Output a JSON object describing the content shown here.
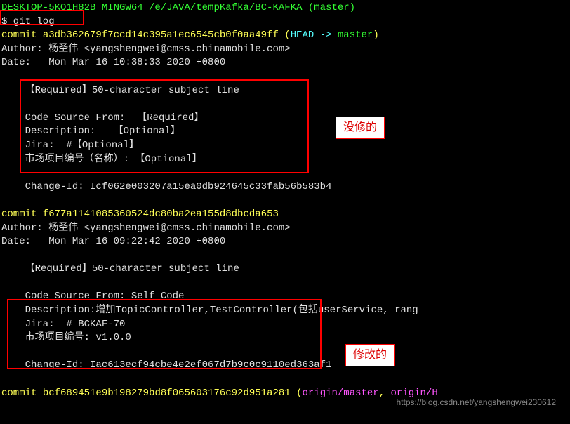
{
  "prompt_prefix": "DESKTOP-5KO1H82B MINGW64 /e/JAVA/tempKafka/BC-KAFKA (master)",
  "command_line": "$ git log",
  "commits": [
    {
      "prefix": "commit ",
      "hash": "a3db362679f7ccd14c395a1ec6545cb0f0aa49ff",
      "head_open": " (",
      "head_ref": "HEAD -> ",
      "head_branch": "master",
      "head_close": ")",
      "author_line": "Author: 杨圣伟 <yangshengwei@cmss.chinamobile.com>",
      "date_line": "Date:   Mon Mar 16 10:38:33 2020 +0800",
      "subject": "    【Required】50-character subject line",
      "body1": "    Code Source From:  【Required】",
      "body2": "    Description:   【Optional】",
      "body3": "    Jira:  #【Optional】",
      "body4": "    市场项目编号（名称）: 【Optional】",
      "change_id": "    Change-Id: Icf062e003207a15ea0db924645c33fab56b583b4"
    },
    {
      "prefix": "commit ",
      "hash": "f677a1141085360524dc80ba2ea155d8dbcda653",
      "author_line": "Author: 杨圣伟 <yangshengwei@cmss.chinamobile.com>",
      "date_line": "Date:   Mon Mar 16 09:22:42 2020 +0800",
      "subject": "    【Required】50-character subject line",
      "body1": "    Code Source From: Self Code",
      "body2": "    Description:增加TopicController,TestController(包括userService, rang",
      "body3": "    Jira:  # BCKAF-70",
      "body4": "    市场项目编号: v1.0.0",
      "change_id": "    Change-Id: Iac613ecf94cbe4e2ef067d7b9c0c9110ed363af1"
    },
    {
      "prefix": "commit ",
      "hash": "bcf689451e9b198279bd8f065603176c92d951a281",
      "remote_open": " (",
      "remote1": "origin/master",
      "remote_sep": ", ",
      "remote2": "origin/H"
    }
  ],
  "labels": {
    "unmodified": "没修的",
    "modified": "修改的"
  },
  "watermark": "https://blog.csdn.net/yangshengwei230612"
}
